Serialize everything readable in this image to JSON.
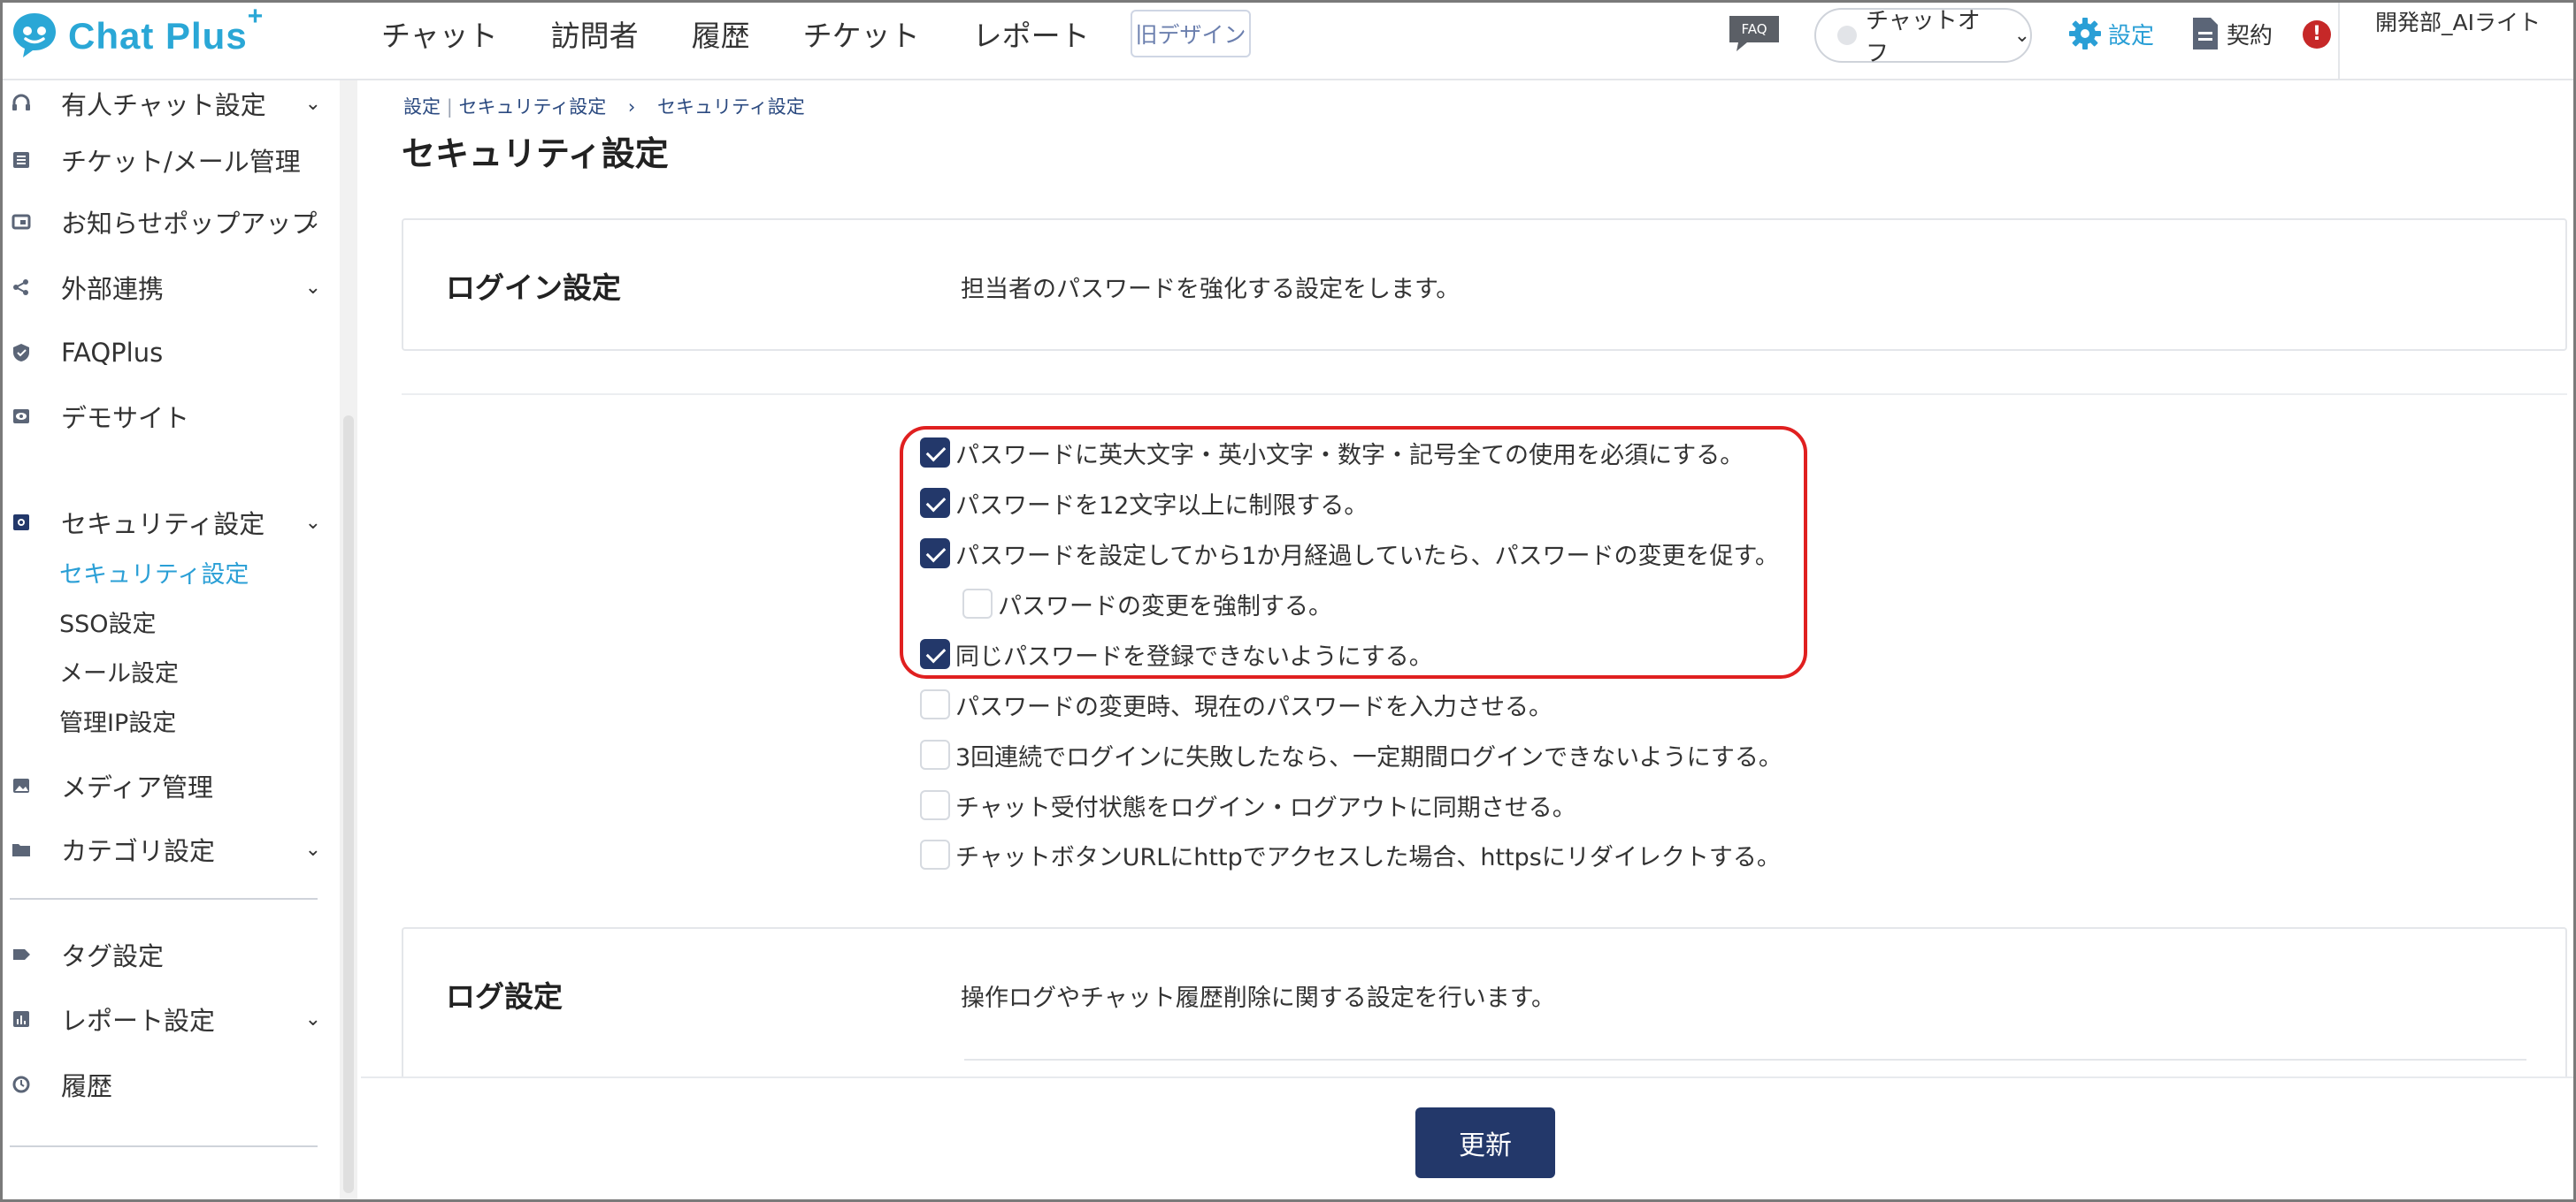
{
  "header": {
    "logo_text": "Chat Plus",
    "logo_plus": "+",
    "nav": [
      "チャット",
      "訪問者",
      "履歴",
      "チケット",
      "レポート"
    ],
    "old_design": "旧デザイン",
    "faq_badge": "FAQ",
    "chat_status": "チャットオフ",
    "settings_label": "設定",
    "contract_label": "契約",
    "alert_mark": "!",
    "user_name": "開発部_AIライト"
  },
  "sidebar": {
    "items": [
      {
        "label": "有人チャット設定",
        "icon": "headset-icon",
        "expandable": true
      },
      {
        "label": "チケット/メール管理",
        "icon": "list-icon",
        "expandable": false
      },
      {
        "label": "お知らせポップアップ",
        "icon": "popup-icon",
        "expandable": true
      },
      {
        "label": "外部連携",
        "icon": "share-icon",
        "expandable": true
      },
      {
        "label": "FAQPlus",
        "icon": "shield-icon",
        "expandable": false
      },
      {
        "label": "デモサイト",
        "icon": "eye-icon",
        "expandable": false
      },
      {
        "label": "セキュリティ設定",
        "icon": "lock-icon",
        "expandable": true
      },
      {
        "label": "メディア管理",
        "icon": "image-icon",
        "expandable": false
      },
      {
        "label": "カテゴリ設定",
        "icon": "folder-icon",
        "expandable": true
      },
      {
        "label": "タグ設定",
        "icon": "tag-icon",
        "expandable": false
      },
      {
        "label": "レポート設定",
        "icon": "chart-icon",
        "expandable": true
      },
      {
        "label": "履歴",
        "icon": "history-icon",
        "expandable": false
      }
    ],
    "security_sub": [
      "セキュリティ設定",
      "SSO設定",
      "メール設定",
      "管理IP設定"
    ]
  },
  "main": {
    "breadcrumb": [
      "設定",
      "セキュリティ設定",
      "セキュリティ設定"
    ],
    "breadcrumb_sep1": "|",
    "breadcrumb_sep2": "›",
    "title": "セキュリティ設定",
    "login_section": {
      "title": "ログイン設定",
      "description": "担当者のパスワードを強化する設定をします。"
    },
    "options": [
      {
        "label": "パスワードに英大文字・英小文字・数字・記号全ての使用を必須にする。",
        "checked": true
      },
      {
        "label": "パスワードを12文字以上に制限する。",
        "checked": true
      },
      {
        "label": "パスワードを設定してから1か月経過していたら、パスワードの変更を促す。",
        "checked": true
      },
      {
        "label": "パスワードの変更を強制する。",
        "checked": false
      },
      {
        "label": "同じパスワードを登録できないようにする。",
        "checked": true
      },
      {
        "label": "パスワードの変更時、現在のパスワードを入力させる。",
        "checked": false
      },
      {
        "label": "3回連続でログインに失敗したなら、一定期間ログインできないようにする。",
        "checked": false
      },
      {
        "label": "チャット受付状態をログイン・ログアウトに同期させる。",
        "checked": false
      },
      {
        "label": "チャットボタンURLにhttpでアクセスした場合、httpsにリダイレクトする。",
        "checked": false
      }
    ],
    "log_section": {
      "title": "ログ設定",
      "description": "操作ログやチャット履歴削除に関する設定を行います。"
    },
    "update_button": "更新"
  },
  "colors": {
    "brand": "#2aa7d6",
    "primary_button": "#23386a",
    "active_link": "#2a9fd6",
    "highlight_border": "#e02020"
  }
}
